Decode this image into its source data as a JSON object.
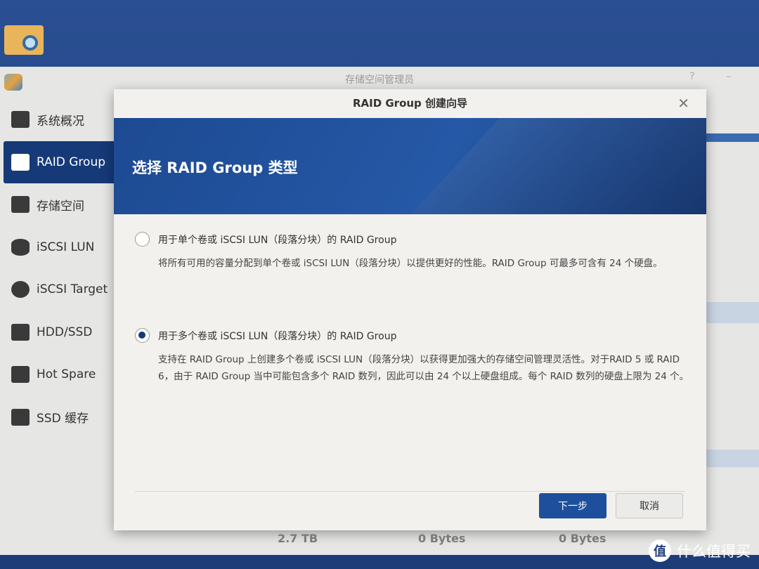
{
  "app": {
    "title": "存储空间管理员"
  },
  "sidebar": {
    "items": [
      {
        "label": "系统概况",
        "icon": "overview-icon"
      },
      {
        "label": "RAID Group",
        "icon": "raid-icon",
        "active": true
      },
      {
        "label": "存储空间",
        "icon": "cubes-icon"
      },
      {
        "label": "iSCSI LUN",
        "icon": "database-icon"
      },
      {
        "label": "iSCSI Target",
        "icon": "globe-icon"
      },
      {
        "label": "HDD/SSD",
        "icon": "disk-icon"
      },
      {
        "label": "Hot Spare",
        "icon": "plus-disk-icon"
      },
      {
        "label": "SSD 缓存",
        "icon": "flash-disk-icon"
      }
    ]
  },
  "background": {
    "values": [
      "2.7 TB",
      "0 Bytes",
      "0 Bytes"
    ]
  },
  "dialog": {
    "title": "RAID Group 创建向导",
    "heading": "选择 RAID Group 类型",
    "options": [
      {
        "label": "用于单个卷或 iSCSI LUN（段落分块）的 RAID Group",
        "description": "将所有可用的容量分配到单个卷或 iSCSI LUN（段落分块）以提供更好的性能。RAID Group 可最多可含有 24 个硬盘。",
        "selected": false
      },
      {
        "label": "用于多个卷或 iSCSI LUN（段落分块）的 RAID Group",
        "description": "支持在 RAID Group 上创建多个卷或 iSCSI LUN（段落分块）以获得更加强大的存储空间管理灵活性。对于RAID 5 或 RAID 6，由于 RAID Group 当中可能包含多个 RAID 数列，因此可以由 24 个以上硬盘组成。每个 RAID 数列的硬盘上限为 24 个。",
        "selected": true
      }
    ],
    "next_label": "下一步",
    "cancel_label": "取消"
  },
  "watermark": {
    "logo": "值",
    "text": "什么值得买"
  },
  "colors": {
    "accent": "#1e4f9c",
    "sidebar_active": "#163a78"
  }
}
